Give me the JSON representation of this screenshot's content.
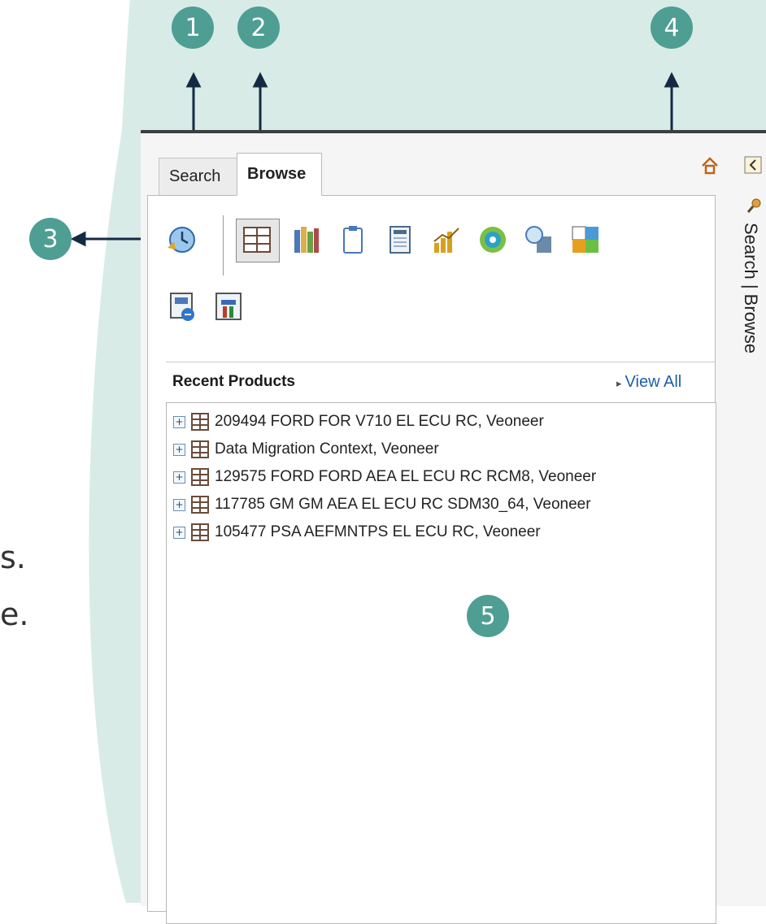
{
  "slide_text": {
    "edge_line_1": "s.",
    "edge_line_2": "e."
  },
  "callouts": [
    "1",
    "2",
    "3",
    "4",
    "5"
  ],
  "tabs": {
    "search": "Search",
    "browse": "Browse"
  },
  "toolbar": {
    "icons": [
      "recent-clock-icon",
      "product-structure-icon",
      "library-icon",
      "clipboard-icon",
      "spreadsheet-icon",
      "chart-icon",
      "target-icon",
      "magnifier-icon",
      "tiles-icon",
      "filter-icon",
      "tools-icon"
    ]
  },
  "recent_products": {
    "title": "Recent Products",
    "view_all": "View All",
    "items": [
      "209494 FORD FOR V710 EL ECU RC, Veoneer",
      "Data Migration Context, Veoneer",
      "129575 FORD FORD AEA EL ECU RC RCM8, Veoneer",
      "117785 GM GM AEA EL ECU RC SDM30_64, Veoneer",
      "105477 PSA AEFMNTPS EL ECU RC, Veoneer"
    ]
  },
  "side_panel": {
    "label": "Search | Browse"
  },
  "colors": {
    "callout": "#4e9e93",
    "background_blob": "#d8ebe7",
    "link": "#1f5ea8"
  }
}
